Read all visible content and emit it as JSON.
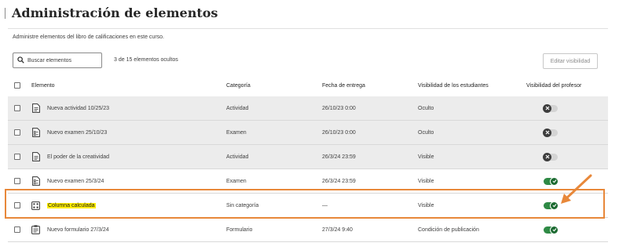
{
  "page": {
    "title": "Administración de elementos",
    "description": "Administre elementos del libro de calificaciones en este curso."
  },
  "toolbar": {
    "search_placeholder": "Buscar elementos",
    "hidden_count": "3 de 15 elementos ocultos",
    "edit_visibility_label": "Editar visibilidad"
  },
  "table": {
    "headers": {
      "element": "Elemento",
      "category": "Categoría",
      "due_date": "Fecha de entrega",
      "student_visibility": "Visibilidad de los estudiantes",
      "teacher_visibility": "Visibilidad del profesor"
    },
    "rows": [
      {
        "name": "Nueva actividad 10/25/23",
        "icon": "document-icon",
        "category": "Actividad",
        "due_date": "26/10/23 0:00",
        "student_visibility": "Oculto",
        "teacher_visible": false
      },
      {
        "name": "Nuevo examen 25/10/23",
        "icon": "test-icon",
        "category": "Examen",
        "due_date": "26/10/23 0:00",
        "student_visibility": "Oculto",
        "teacher_visible": false
      },
      {
        "name": "El poder de la creatividad",
        "icon": "document-icon",
        "category": "Actividad",
        "due_date": "26/3/24 23:59",
        "student_visibility": "Visible",
        "teacher_visible": false
      },
      {
        "name": "Nuevo examen 25/3/24",
        "icon": "test-icon",
        "category": "Examen",
        "due_date": "26/3/24 23:59",
        "student_visibility": "Visible",
        "teacher_visible": true
      },
      {
        "name": "Columna calculada",
        "icon": "calculator-icon",
        "category": "Sin categoría",
        "due_date": "—",
        "student_visibility": "Visible",
        "teacher_visible": true,
        "highlighted": true
      },
      {
        "name": "Nuevo formulario 27/3/24",
        "icon": "form-icon",
        "category": "Formulario",
        "due_date": "27/3/24 9:40",
        "student_visibility": "Condición de publicación",
        "teacher_visible": true
      }
    ]
  },
  "colors": {
    "toggle_on": "#2f8a45",
    "toggle_off": "#d4d4d4",
    "annotation": "#e8883a",
    "highlight": "#ffee00"
  }
}
